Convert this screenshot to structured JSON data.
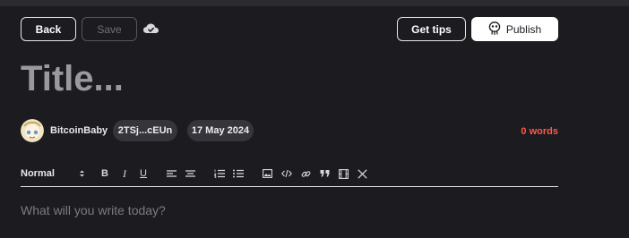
{
  "toolbar": {
    "back_label": "Back",
    "save_label": "Save",
    "get_tips_label": "Get tips",
    "publish_label": "Publish",
    "cloud_icon": "cloud-icon",
    "publish_icon": "mascot-icon"
  },
  "editor": {
    "title_placeholder": "Title...",
    "body_placeholder": "What will you write today?"
  },
  "meta": {
    "author_name": "BitcoinBaby",
    "address": "2TSj...cEUn",
    "date": "17 May 2024",
    "word_count": "0 words"
  },
  "format_bar": {
    "block_style": "Normal",
    "buttons": [
      "B",
      "I",
      "U"
    ]
  },
  "colors": {
    "background": "#1c1b20",
    "chip": "#36353b",
    "word_count": "#ff5a4b",
    "publish_bg": "#ffffff"
  }
}
